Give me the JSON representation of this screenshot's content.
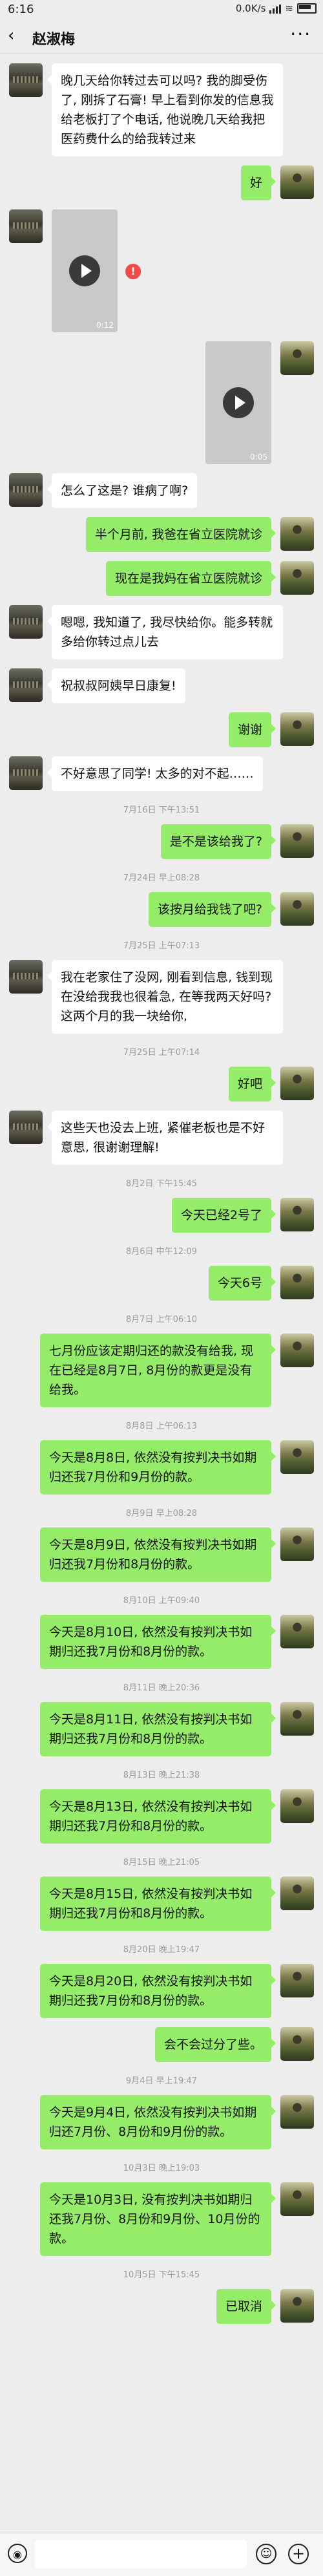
{
  "status": {
    "time": "6:16",
    "net": "0.0K/s"
  },
  "header": {
    "back": "‹",
    "title": "赵淑梅",
    "more": "···"
  },
  "messages": [
    {
      "type": "text",
      "side": "left",
      "text": "晚几天给你转过去可以吗? 我的脚受伤了, 刚拆了石膏! 早上看到你发的信息我给老板打了个电话, 他说晚几天给我把医药费什么的给我转过来"
    },
    {
      "type": "text",
      "side": "right",
      "text": "好"
    },
    {
      "type": "video",
      "side": "left",
      "duration": "0:12",
      "failed": true
    },
    {
      "type": "video",
      "side": "right",
      "duration": "0:05"
    },
    {
      "type": "text",
      "side": "left",
      "text": "怎么了这是? 谁病了啊?"
    },
    {
      "type": "text",
      "side": "right",
      "text": "半个月前, 我爸在省立医院就诊"
    },
    {
      "type": "text",
      "side": "right",
      "text": "现在是我妈在省立医院就诊"
    },
    {
      "type": "text",
      "side": "left",
      "text": "嗯嗯, 我知道了, 我尽快给你。能多转就多给你转过点儿去"
    },
    {
      "type": "text",
      "side": "left",
      "text": "祝叔叔阿姨早日康复!"
    },
    {
      "type": "text",
      "side": "right",
      "text": "谢谢"
    },
    {
      "type": "text",
      "side": "left",
      "text": "不好意思了同学! 太多的对不起……"
    },
    {
      "type": "time",
      "text": "7月16日 下午13:51"
    },
    {
      "type": "text",
      "side": "right",
      "text": "是不是该给我了?"
    },
    {
      "type": "time",
      "text": "7月24日 早上08:28"
    },
    {
      "type": "text",
      "side": "right",
      "text": "该按月给我钱了吧?"
    },
    {
      "type": "time",
      "text": "7月25日 上午07:13"
    },
    {
      "type": "text",
      "side": "left",
      "text": "我在老家住了没网, 刚看到信息, 钱到现在没给我我也很着急, 在等我两天好吗? 这两个月的我一块给你,"
    },
    {
      "type": "time",
      "text": "7月25日 上午07:14"
    },
    {
      "type": "text",
      "side": "right",
      "text": "好吧"
    },
    {
      "type": "text",
      "side": "left",
      "text": "这些天也没去上班, 紧催老板也是不好意思, 很谢谢理解!"
    },
    {
      "type": "time",
      "text": "8月2日 下午15:45"
    },
    {
      "type": "text",
      "side": "right",
      "text": "今天已经2号了"
    },
    {
      "type": "time",
      "text": "8月6日 中午12:09"
    },
    {
      "type": "text",
      "side": "right",
      "text": "今天6号"
    },
    {
      "type": "time",
      "text": "8月7日 上午06:10"
    },
    {
      "type": "text",
      "side": "right",
      "text": "七月份应该定期归还的款没有给我, 现在已经是8月7日, 8月份的款更是没有给我。"
    },
    {
      "type": "time",
      "text": "8月8日 上午06:13"
    },
    {
      "type": "text",
      "side": "right",
      "text": "今天是8月8日, 依然没有按判决书如期归还我7月份和9月份的款。"
    },
    {
      "type": "time",
      "text": "8月9日 早上08:28"
    },
    {
      "type": "text",
      "side": "right",
      "text": "今天是8月9日, 依然没有按判决书如期归还我7月份和8月份的款。"
    },
    {
      "type": "time",
      "text": "8月10日 上午09:40"
    },
    {
      "type": "text",
      "side": "right",
      "text": "今天是8月10日, 依然没有按判决书如期归还我7月份和8月份的款。"
    },
    {
      "type": "time",
      "text": "8月11日 晚上20:36"
    },
    {
      "type": "text",
      "side": "right",
      "text": "今天是8月11日, 依然没有按判决书如期归还我7月份和8月份的款。"
    },
    {
      "type": "time",
      "text": "8月13日 晚上21:38"
    },
    {
      "type": "text",
      "side": "right",
      "text": "今天是8月13日, 依然没有按判决书如期归还我7月份和8月份的款。"
    },
    {
      "type": "time",
      "text": "8月15日 晚上21:05"
    },
    {
      "type": "text",
      "side": "right",
      "text": "今天是8月15日, 依然没有按判决书如期归还我7月份和8月份的款。"
    },
    {
      "type": "time",
      "text": "8月20日 晚上19:47"
    },
    {
      "type": "text",
      "side": "right",
      "text": "今天是8月20日, 依然没有按判决书如期归还我7月份和8月份的款。"
    },
    {
      "type": "text",
      "side": "right",
      "text": "会不会过分了些。"
    },
    {
      "type": "time",
      "text": "9月4日 早上19:47"
    },
    {
      "type": "text",
      "side": "right",
      "text": "今天是9月4日, 依然没有按判决书如期归还7月份、8月份和9月份的款。"
    },
    {
      "type": "time",
      "text": "10月3日 晚上19:03"
    },
    {
      "type": "text",
      "side": "right",
      "text": "今天是10月3日, 没有按判决书如期归还我7月份、8月份和9月份、10月份的款。"
    },
    {
      "type": "time",
      "text": "10月5日 下午15:45"
    },
    {
      "type": "text",
      "side": "right",
      "text": "已取消"
    }
  ],
  "icons": {
    "back": "chevron-left-icon",
    "more": "more-icon",
    "voice": "voice-icon",
    "emoji": "emoji-icon",
    "plus": "plus-icon",
    "play": "play-icon",
    "error": "error-icon"
  },
  "colors": {
    "background": "#ededed",
    "my_bubble": "#95ec69",
    "their_bubble": "#ffffff",
    "error": "#f04a4a"
  },
  "inputbar": {
    "voice_glyph": "◉",
    "emoji_glyph": "☺",
    "plus_glyph": "+"
  },
  "error_glyph": "!"
}
